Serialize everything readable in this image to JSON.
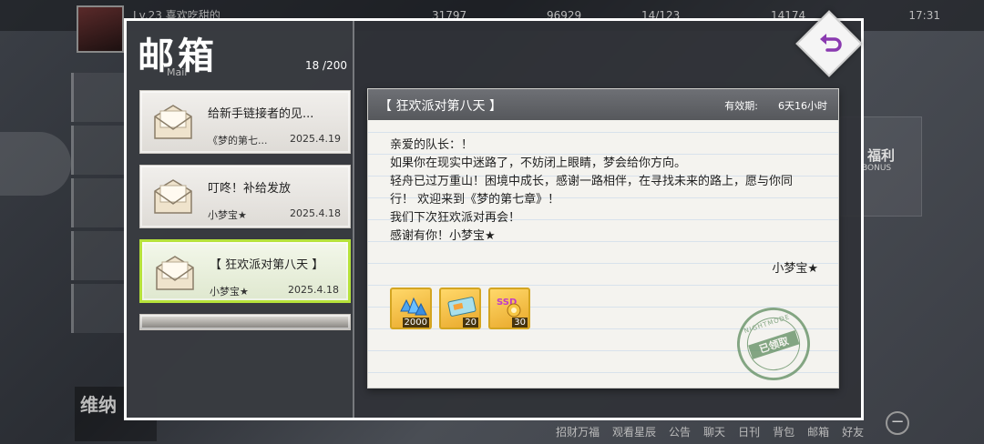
{
  "hud": {
    "level": "Lv.23",
    "player_name": "喜欢吃甜的",
    "resources": [
      "31797",
      "96929",
      "14/123",
      "14174"
    ],
    "clock": "17:31"
  },
  "sidebar_bg": {
    "bonus_cn": "福利",
    "bonus_en": "BONUS",
    "bottom_left": "维纳",
    "bottom_nav": [
      "招财万福",
      "观看星辰",
      "公告",
      "聊天",
      "日刊",
      "背包",
      "邮箱",
      "好友"
    ]
  },
  "mailbox": {
    "title": "邮箱",
    "title_en": "Mail",
    "count": "18 /200"
  },
  "mails": [
    {
      "title": "给新手链接者的见...",
      "sender": "《梦的第七...",
      "date": "2025.4.19"
    },
    {
      "title": "叮咚！补给发放",
      "sender": "小梦宝★",
      "date": "2025.4.18"
    },
    {
      "title": "【 狂欢派对第八天 】",
      "sender": "小梦宝★",
      "date": "2025.4.18"
    }
  ],
  "letter": {
    "subject": "【 狂欢派对第八天 】",
    "valid_label": "有效期:",
    "valid_value": "6天16小时",
    "lines": [
      "亲爱的队长：！",
      "如果你在现实中迷路了，不妨闭上眼睛，梦会给你方向。",
      "轻舟已过万重山！困境中成长，感谢一路相伴，在寻找未来的路上，愿与你同",
      "行！ 欢迎来到《梦的第七章》！",
      "我们下次狂欢派对再会！",
      "感谢有你！小梦宝★"
    ],
    "signature": "小梦宝★",
    "rewards": [
      {
        "icon": "blue-crystal-icon",
        "count": "2000"
      },
      {
        "icon": "ticket-card-icon",
        "count": "20"
      },
      {
        "icon": "ssd-item-icon",
        "count": "30"
      }
    ],
    "stamp_ring": "NIGHTMODE",
    "stamp_text": "已领取"
  },
  "colors": {
    "selected_border": "#b6e23a",
    "stamp": "#5e8c5e",
    "panel_border": "#ffffff"
  }
}
